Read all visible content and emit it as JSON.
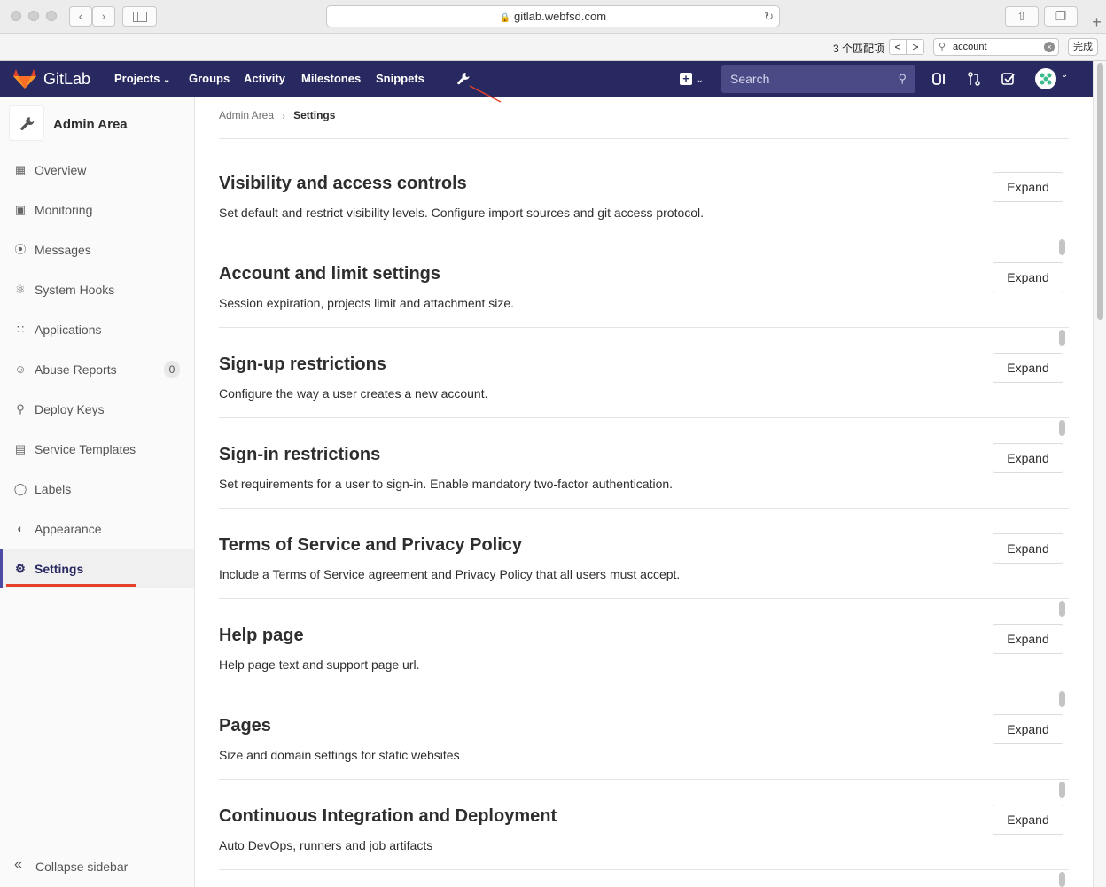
{
  "browser": {
    "url": "gitlab.webfsd.com",
    "find": {
      "count_label": "3 个匹配项",
      "query": "account",
      "done_label": "完成"
    }
  },
  "navbar": {
    "brand": "GitLab",
    "links": [
      "Projects",
      "Groups",
      "Activity",
      "Milestones",
      "Snippets"
    ],
    "search_placeholder": "Search"
  },
  "sidebar": {
    "title": "Admin Area",
    "items": [
      {
        "label": "Overview",
        "icon": "overview-icon"
      },
      {
        "label": "Monitoring",
        "icon": "monitor-icon"
      },
      {
        "label": "Messages",
        "icon": "broadcast-icon"
      },
      {
        "label": "System Hooks",
        "icon": "hook-icon"
      },
      {
        "label": "Applications",
        "icon": "apps-grid-icon"
      },
      {
        "label": "Abuse Reports",
        "icon": "abuse-face-icon",
        "badge": "0"
      },
      {
        "label": "Deploy Keys",
        "icon": "key-icon"
      },
      {
        "label": "Service Templates",
        "icon": "template-icon"
      },
      {
        "label": "Labels",
        "icon": "label-icon"
      },
      {
        "label": "Appearance",
        "icon": "palette-icon"
      },
      {
        "label": "Settings",
        "icon": "gear-icon",
        "active": true
      }
    ],
    "collapse_label": "Collapse sidebar"
  },
  "breadcrumb": {
    "parent": "Admin Area",
    "current": "Settings"
  },
  "sections": [
    {
      "title": "Visibility and access controls",
      "description": "Set default and restrict visibility levels. Configure import sources and git access protocol.",
      "button": "Expand"
    },
    {
      "title": "Account and limit settings",
      "description": "Session expiration, projects limit and attachment size.",
      "button": "Expand"
    },
    {
      "title": "Sign-up restrictions",
      "description": "Configure the way a user creates a new account.",
      "button": "Expand"
    },
    {
      "title": "Sign-in restrictions",
      "description": "Set requirements for a user to sign-in. Enable mandatory two-factor authentication.",
      "button": "Expand"
    },
    {
      "title": "Terms of Service and Privacy Policy",
      "description": "Include a Terms of Service agreement and Privacy Policy that all users must accept.",
      "button": "Expand"
    },
    {
      "title": "Help page",
      "description": "Help page text and support page url.",
      "button": "Expand"
    },
    {
      "title": "Pages",
      "description": "Size and domain settings for static websites",
      "button": "Expand"
    },
    {
      "title": "Continuous Integration and Deployment",
      "description": "Auto DevOps, runners and job artifacts",
      "button": "Expand"
    }
  ],
  "colors": {
    "navbar": "#292961",
    "accent": "#4b4ba3",
    "annotation": "#e8412b"
  }
}
